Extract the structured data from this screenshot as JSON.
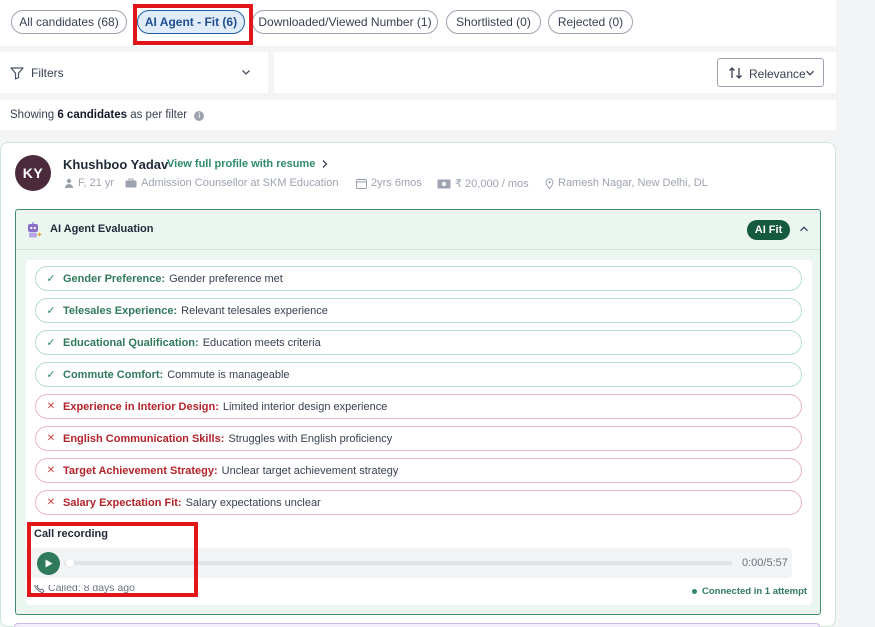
{
  "tabs": [
    {
      "label": "All candidates (68)",
      "active": false
    },
    {
      "label": "AI Agent - Fit (6)",
      "active": true
    },
    {
      "label": "Downloaded/Viewed Number (1)",
      "active": false
    },
    {
      "label": "Shortlisted (0)",
      "active": false
    },
    {
      "label": "Rejected (0)",
      "active": false
    }
  ],
  "filters": {
    "label": "Filters",
    "icon": "filter-icon"
  },
  "sort": {
    "label": "Relevance",
    "icon": "sort-icon"
  },
  "showing": {
    "prefix": "Showing",
    "count": "6 candidates",
    "suffix": "as per filter",
    "info_icon": "i"
  },
  "candidate": {
    "initials": "KY",
    "name": "Khushboo Yadav",
    "view_link": "View full profile with resume",
    "gender_age": "F, 21 yr",
    "role": "Admission Counsellor at SKM Education",
    "experience": "2yrs 6mos",
    "salary": "₹ 20,000 / mos",
    "location": "Ramesh Nagar, New Delhi, DL"
  },
  "evaluation": {
    "title": "AI Agent Evaluation",
    "badge": "AI Fit",
    "pass_mark": "✓",
    "fail_mark": "✕",
    "criteria": [
      {
        "label": "Gender Preference:",
        "value": "Gender preference met",
        "status": "pass"
      },
      {
        "label": "Telesales Experience:",
        "value": "Relevant telesales experience",
        "status": "pass"
      },
      {
        "label": "Educational Qualification:",
        "value": "Education meets criteria",
        "status": "pass"
      },
      {
        "label": "Commute Comfort:",
        "value": "Commute is manageable",
        "status": "pass"
      },
      {
        "label": "Experience in Interior Design:",
        "value": "Limited interior design experience",
        "status": "fail"
      },
      {
        "label": "English Communication Skills:",
        "value": "Struggles with English proficiency",
        "status": "fail"
      },
      {
        "label": "Target Achievement Strategy:",
        "value": "Unclear target achievement strategy",
        "status": "fail"
      },
      {
        "label": "Salary Expectation Fit:",
        "value": "Salary expectations unclear",
        "status": "fail"
      }
    ]
  },
  "call": {
    "title": "Call recording",
    "time": "0:00/5:57",
    "progress": 0,
    "called": "Called: 8 days ago",
    "connected": "Connected in 1 attempt"
  },
  "colors": {
    "accent_green": "#2f7a5a",
    "badge_green": "#15593f",
    "fail_red": "#b4232a",
    "highlight_red": "#e0161b",
    "active_tab_bg": "#e0ecfa"
  }
}
